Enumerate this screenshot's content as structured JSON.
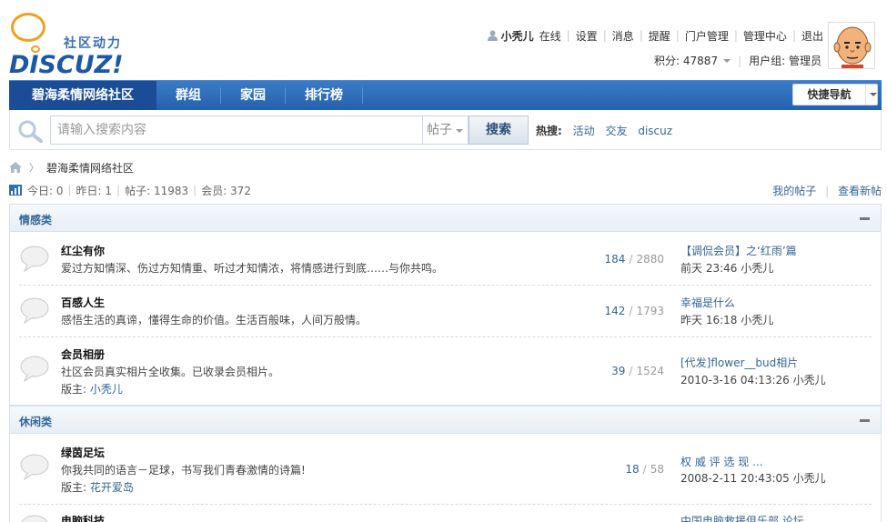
{
  "logo": {
    "slogan": "社区动力",
    "brand": "DISCUZ!"
  },
  "user": {
    "name": "小秃儿",
    "status": "在线",
    "links": [
      "设置",
      "消息",
      "提醒",
      "门户管理",
      "管理中心",
      "退出"
    ],
    "points_label": "积分: 47887",
    "group_label": "用户组: 管理员"
  },
  "nav": {
    "items": [
      "碧海柔情网络社区",
      "群组",
      "家园",
      "排行榜"
    ],
    "active_index": 0,
    "quicknav_label": "快捷导航"
  },
  "search": {
    "placeholder": "请输入搜索内容",
    "type": "帖子",
    "button": "搜索",
    "hot_label": "热搜:",
    "hot_words": [
      "活动",
      "交友",
      "discuz"
    ]
  },
  "breadcrumb": {
    "current": "碧海柔情网络社区"
  },
  "stats": {
    "today": "今日: 0",
    "yesterday": "昨日: 1",
    "posts": "帖子: 11983",
    "members": "会员: 372",
    "links": [
      "我的帖子",
      "查看新帖"
    ]
  },
  "groups": [
    {
      "title": "情感类",
      "forums": [
        {
          "name": "红尘有你",
          "desc": "爱过方知情深、伤过方知情重、听过才知情浓，将情感进行到底……与你共鸣。",
          "moderator_label": "",
          "moderator": "",
          "threads": "184",
          "posts": "2880",
          "last_title": "【调侃会员】之‘红雨’篇",
          "last_time": "前天 23:46 小秃儿"
        },
        {
          "name": "百感人生",
          "desc": "感悟生活的真谛，懂得生命的价值。生活百般味，人间万般情。",
          "moderator_label": "",
          "moderator": "",
          "threads": "142",
          "posts": "1793",
          "last_title": "幸福是什么",
          "last_time": "昨天 16:18 小秃儿"
        },
        {
          "name": "会员相册",
          "desc": "社区会员真实相片全收集。已收录会员相片。",
          "moderator_label": "版主:",
          "moderator": "小秃儿",
          "threads": "39",
          "posts": "1524",
          "last_title": "[代发]flower__bud相片",
          "last_time": "2010-3-16 04:13:26 小秃儿"
        }
      ]
    },
    {
      "title": "休闲类",
      "forums": [
        {
          "name": "绿茵足坛",
          "desc": "你我共同的语言－足球，书写我们青春激情的诗篇!",
          "moderator_label": "版主:",
          "moderator": "花开爱岛",
          "threads": "18",
          "posts": "58",
          "last_title": "权 威 评 选 现 ...",
          "last_time": "2008-2-11 20:43:05 小秃儿"
        },
        {
          "name": "电脑科技",
          "desc": "",
          "moderator_label": "",
          "moderator": "",
          "threads": "",
          "posts": "",
          "last_title": "中国电脑救援俱乐部 论坛",
          "last_time": ""
        }
      ]
    }
  ],
  "colors": {
    "nav_blue": "#2461ae",
    "nav_active": "#1a4d96",
    "link_blue": "#336699",
    "logo_orange": "#f0a020"
  }
}
